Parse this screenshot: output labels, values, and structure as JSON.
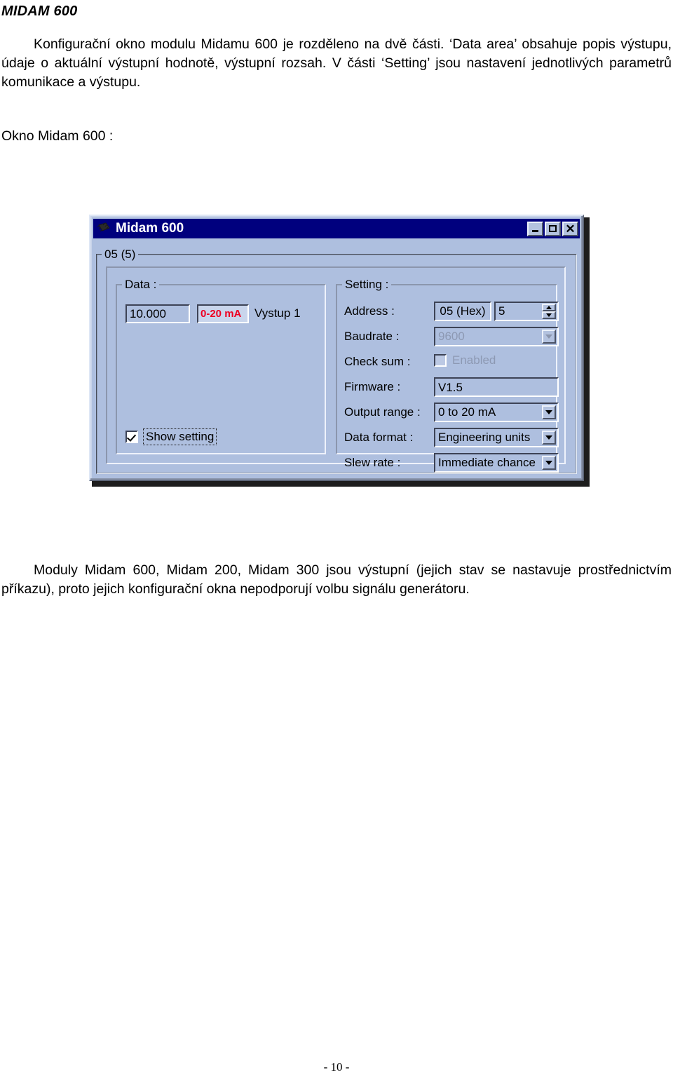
{
  "document": {
    "heading": "MIDAM 600",
    "paragraph_1": "Konfigurační okno modulu Midamu 600 je rozděleno na dvě části. ‘Data area’ obsahuje popis výstupu, údaje o aktuální výstupní hodnotě, výstupní rozsah. V části ‘Setting’ jsou nastavení jednotlivých parametrů komunikace a výstupu.",
    "caption": "Okno Midam 600 :",
    "paragraph_2": "Moduly Midam 600, Midam 200, Midam 300 jsou výstupní (jejich stav se nastavuje prostřednictvím příkazu), proto jejich konfigurační okna nepodporují volbu signálu generátoru.",
    "page_number": "- 10 -"
  },
  "dialog": {
    "title": "Midam 600",
    "icon": "chip-icon",
    "title_buttons": {
      "minimize": "_",
      "maximize": "□",
      "close": "X"
    },
    "group_label": "05 (5)",
    "data_group": {
      "caption": "Data :",
      "value": "10.000",
      "range_badge": "0-20 mA",
      "range_badge_color": "#ee0022",
      "output_label": "Vystup 1",
      "show_setting": {
        "label": "Show setting",
        "checked": true
      }
    },
    "setting_group": {
      "caption": "Setting :",
      "rows": [
        {
          "label": "Address :",
          "hex_value": "05 (Hex)",
          "value": "5",
          "control": "spinner",
          "disabled": false
        },
        {
          "label": "Baudrate :",
          "value": "9600",
          "control": "combo",
          "disabled": true
        },
        {
          "label": "Check sum :",
          "value": "Enabled",
          "control": "checkbox",
          "disabled": true,
          "checked": false
        },
        {
          "label": "Firmware :",
          "value": "V1.5",
          "control": "textbox",
          "disabled": false
        },
        {
          "label": "Output range :",
          "value": "0 to 20 mA",
          "control": "combo",
          "disabled": false
        },
        {
          "label": "Data format :",
          "value": "Engineering units",
          "control": "combo",
          "disabled": false
        },
        {
          "label": "Slew rate :",
          "value": "Immediate chance",
          "control": "combo",
          "disabled": false
        }
      ]
    },
    "colors": {
      "titlebar": "#00007e",
      "face": "#aebfdf",
      "shadow": "#5c6476",
      "highlight": "#dfe7f5"
    }
  }
}
